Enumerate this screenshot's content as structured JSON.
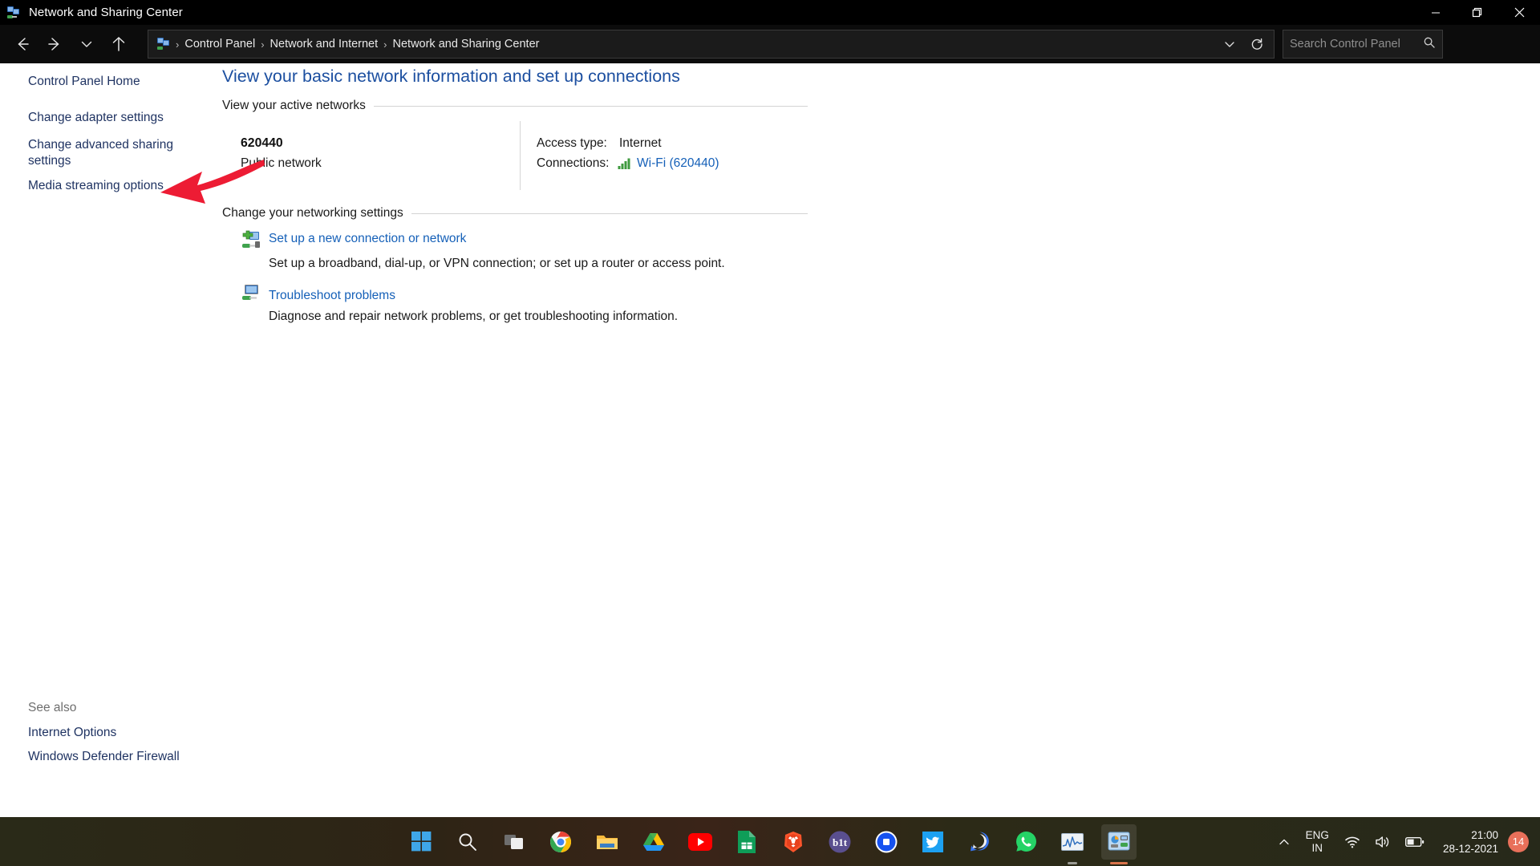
{
  "window": {
    "title": "Network and Sharing Center",
    "icon": "network-sharing-icon",
    "controls": {
      "minimize": "Minimize",
      "restore": "Restore",
      "close": "Close"
    }
  },
  "nav": {
    "back": "Back",
    "forward": "Forward",
    "recent": "Recent locations",
    "up": "Up to Network and Internet",
    "breadcrumb": [
      "Control Panel",
      "Network and Internet",
      "Network and Sharing Center"
    ],
    "separator": "›",
    "dropdown": "Previous locations",
    "refresh": "Refresh",
    "search": {
      "placeholder": "Search Control Panel",
      "value": ""
    }
  },
  "sidebar": {
    "items": [
      {
        "label": "Control Panel Home"
      },
      {
        "label": "Change adapter settings"
      },
      {
        "label": "Change advanced sharing settings"
      },
      {
        "label": "Media streaming options"
      }
    ],
    "see_also_label": "See also",
    "see_also": [
      {
        "label": "Internet Options"
      },
      {
        "label": "Windows Defender Firewall"
      }
    ]
  },
  "main": {
    "page_title": "View your basic network information and set up connections",
    "active_networks_heading": "View your active networks",
    "network": {
      "name": "620440",
      "type": "Public network",
      "access_type_label": "Access type:",
      "access_type_value": "Internet",
      "connections_label": "Connections:",
      "connections_link": "Wi-Fi (620440)",
      "connections_icon": "wifi-signal-bars-icon"
    },
    "change_settings_heading": "Change your networking settings",
    "tasks": [
      {
        "icon": "new-connection-icon",
        "link": "Set up a new connection or network",
        "description": "Set up a broadband, dial-up, or VPN connection; or set up a router or access point."
      },
      {
        "icon": "troubleshoot-icon",
        "link": "Troubleshoot problems",
        "description": "Diagnose and repair network problems, or get troubleshooting information."
      }
    ]
  },
  "annotation": {
    "arrow": "red-arrow-pointing-to-change-adapter-settings",
    "color": "#ed1c34"
  },
  "taskbar": {
    "apps": [
      {
        "name": "start-button",
        "label": "Start"
      },
      {
        "name": "search-button",
        "label": "Search"
      },
      {
        "name": "task-view-button",
        "label": "Task View"
      },
      {
        "name": "chrome-button",
        "label": "Google Chrome"
      },
      {
        "name": "file-explorer-button",
        "label": "File Explorer"
      },
      {
        "name": "google-drive-button",
        "label": "Google Drive"
      },
      {
        "name": "youtube-button",
        "label": "YouTube"
      },
      {
        "name": "google-sheets-button",
        "label": "Google Sheets"
      },
      {
        "name": "brave-button",
        "label": "Brave"
      },
      {
        "name": "bit-button",
        "label": "bit"
      },
      {
        "name": "coinbase-button",
        "label": "Coinbase"
      },
      {
        "name": "twitter-button",
        "label": "Twitter"
      },
      {
        "name": "signal-button",
        "label": "Signal"
      },
      {
        "name": "whatsapp-button",
        "label": "WhatsApp"
      },
      {
        "name": "task-manager-button",
        "label": "Task Manager"
      },
      {
        "name": "network-sharing-center-button",
        "label": "Network and Sharing Center"
      }
    ],
    "tray": {
      "show_hidden": "Show hidden icons",
      "language_line1": "ENG",
      "language_line2": "IN",
      "wifi": "Wi-Fi",
      "volume": "Volume",
      "battery": "Battery",
      "time": "21:00",
      "date": "28-12-2021",
      "notification_count": "14"
    },
    "colors": {
      "accent_indicator": "#d9744b",
      "notification_badge": "#e8705a"
    }
  }
}
